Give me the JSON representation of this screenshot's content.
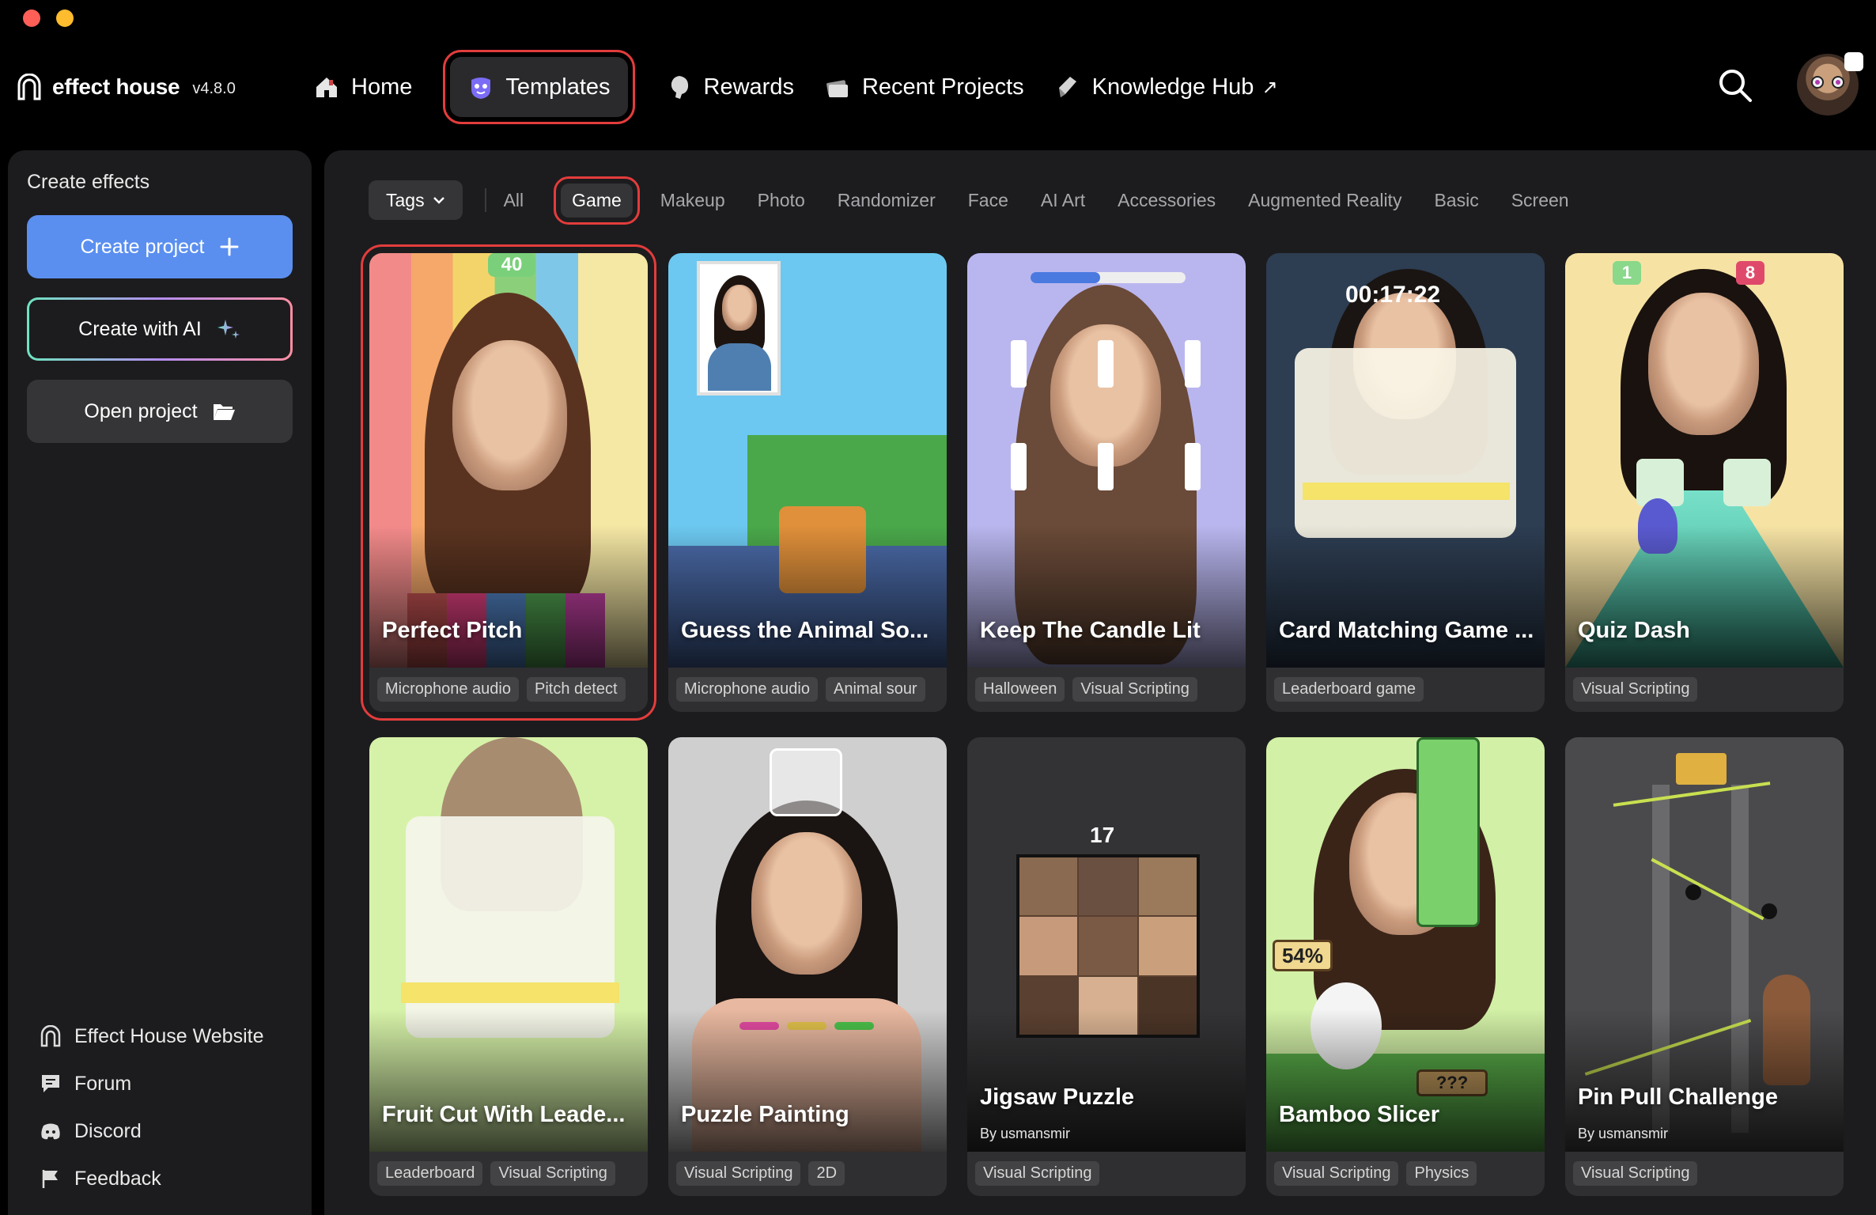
{
  "app": {
    "name": "effect house",
    "version": "v4.8.0"
  },
  "nav": {
    "items": [
      {
        "label": "Home",
        "icon": "home-icon"
      },
      {
        "label": "Templates",
        "icon": "templates-icon",
        "active": true
      },
      {
        "label": "Rewards",
        "icon": "rewards-icon"
      },
      {
        "label": "Recent Projects",
        "icon": "recent-projects-icon"
      },
      {
        "label": "Knowledge Hub",
        "icon": "knowledge-hub-icon",
        "external": "↗"
      }
    ]
  },
  "sidebar": {
    "heading": "Create effects",
    "buttons": {
      "create": "Create project",
      "ai": "Create with AI",
      "open": "Open project"
    },
    "links": [
      {
        "label": "Effect House Website",
        "icon": "website-icon"
      },
      {
        "label": "Forum",
        "icon": "forum-icon"
      },
      {
        "label": "Discord",
        "icon": "discord-icon"
      },
      {
        "label": "Feedback",
        "icon": "flag-icon"
      }
    ]
  },
  "filters": {
    "tags_label": "Tags",
    "chips": [
      "All",
      "Game",
      "Makeup",
      "Photo",
      "Randomizer",
      "Face",
      "AI Art",
      "Accessories",
      "Augmented Reality",
      "Basic",
      "Screen"
    ],
    "active": "Game"
  },
  "templates": [
    {
      "title": "Perfect Pitch",
      "tags": [
        "Microphone audio",
        "Pitch detect"
      ],
      "overlay": "40"
    },
    {
      "title": "Guess the Animal So...",
      "tags": [
        "Microphone audio",
        "Animal sour"
      ]
    },
    {
      "title": "Keep The Candle Lit",
      "tags": [
        "Halloween",
        "Visual Scripting"
      ]
    },
    {
      "title": "Card Matching Game ...",
      "tags": [
        "Leaderboard game"
      ],
      "overlay": "00:17:22"
    },
    {
      "title": "Quiz Dash",
      "tags": [
        "Visual Scripting"
      ],
      "overlay_left": "1",
      "overlay_right": "8"
    },
    {
      "title": "Fruit Cut With Leade...",
      "tags": [
        "Leaderboard",
        "Visual Scripting"
      ]
    },
    {
      "title": "Puzzle Painting",
      "tags": [
        "Visual Scripting",
        "2D"
      ]
    },
    {
      "title": "Jigsaw Puzzle",
      "by": "By usmansmir",
      "tags": [
        "Visual Scripting"
      ],
      "overlay": "17"
    },
    {
      "title": "Bamboo Slicer",
      "tags": [
        "Visual Scripting",
        "Physics"
      ],
      "overlay": "54%",
      "overlay2": "???"
    },
    {
      "title": "Pin Pull Challenge",
      "by": "By usmansmir",
      "tags": [
        "Visual Scripting"
      ]
    }
  ],
  "colors": {
    "accent_blue": "#5a8ff0",
    "highlight_red": "#e33c3c",
    "panel": "#1c1c1e"
  }
}
